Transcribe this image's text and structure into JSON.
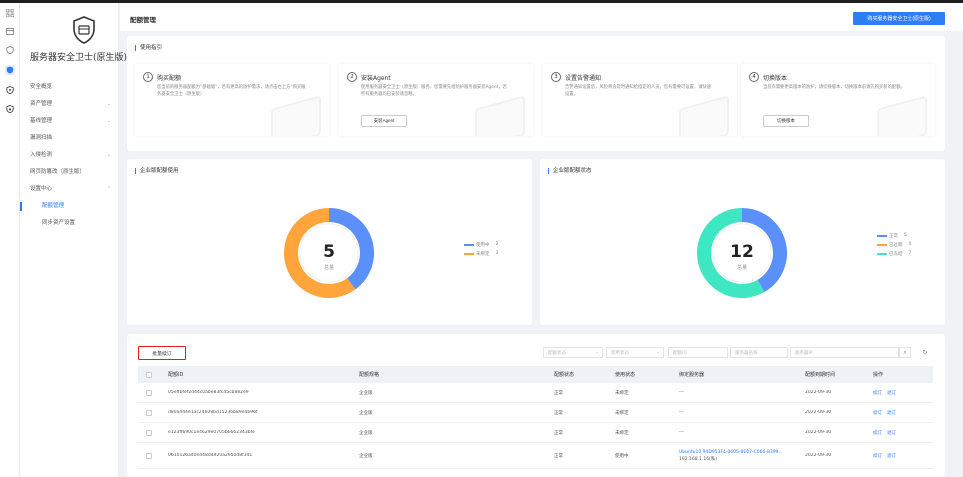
{
  "app": {
    "product_name": "服务器安全卫士(原生版)"
  },
  "rail_icons": [
    "apps-icon",
    "box-icon",
    "shield-check-icon",
    "shield-active-icon",
    "shield-icon",
    "shield-lock-icon"
  ],
  "sidebar": {
    "items": [
      {
        "label": "安全概览",
        "chevron": false
      },
      {
        "label": "资产管理",
        "chevron": true
      },
      {
        "label": "基线管理",
        "chevron": true
      },
      {
        "label": "漏洞扫描",
        "chevron": false
      },
      {
        "label": "入侵检测",
        "chevron": true
      },
      {
        "label": "网页防篡改（原生版）",
        "chevron": false
      },
      {
        "label": "设置中心",
        "chevron": true
      }
    ],
    "sub_items": [
      {
        "label": "配额管理",
        "active": true
      },
      {
        "label": "同步资产设置",
        "active": false
      }
    ]
  },
  "header": {
    "title": "配额管理",
    "buy_button": "购买服务器安全卫士(原生版)"
  },
  "guide": {
    "title": "使用指引",
    "steps": [
      {
        "num": "1",
        "title": "购买配额",
        "desc": "您当前的服务器配额为“基础版”，若有更高的防护需求，请点击右上方“购买服务器安全卫士（原生版）",
        "button": ""
      },
      {
        "num": "2",
        "title": "安装Agent",
        "desc": "使用服务器安全卫士（原生版）服务，您需要先给防护服务器安装Agent，若所有服务器均已安装请忽略。",
        "button": "安装Agent"
      },
      {
        "num": "3",
        "title": "设置告警通知",
        "desc": "告警通知设置后，风险将会及时通知给指定的人员，您有需要可设置，请快速设置。",
        "button": ""
      },
      {
        "num": "4",
        "title": "切换版本",
        "desc": "当您有需要更高版本的防护，请切换版本，切换版本前请先购买新的配额。",
        "button": "切换版本"
      }
    ]
  },
  "usage_card": {
    "title": "企业版配额使用",
    "total": "5",
    "total_label": "总量",
    "legend": [
      {
        "label": "使用中",
        "value": "2",
        "color": "#5b8ff9"
      },
      {
        "label": "未绑定",
        "value": "3",
        "color": "#ffa53b"
      }
    ]
  },
  "status_card": {
    "title": "企业版配额状态",
    "total": "12",
    "total_label": "总量",
    "legend": [
      {
        "label": "正常",
        "value": "5",
        "color": "#5b8ff9"
      },
      {
        "label": "已过期",
        "value": "0",
        "color": "#ffa53b"
      },
      {
        "label": "已冻结",
        "value": "7",
        "color": "#3ee6c2"
      }
    ]
  },
  "toolbar": {
    "batch_button": "批量续订",
    "filters": {
      "quota_status": "配额状态",
      "use_status": "使用状态",
      "quota_id": "配额ID",
      "server_name": "服务器名称",
      "server_ip": "服务器IP"
    }
  },
  "table": {
    "headers": {
      "id": "配额ID",
      "spec": "配额规格",
      "status": "配额状态",
      "use": "使用状态",
      "server": "绑定服务器",
      "expire": "配额到期时间",
      "ops": "操作"
    },
    "rows": [
      {
        "id": "05effbfef2d44c0abe83fc45cb882e9",
        "spec": "企业版",
        "status": "正常",
        "use": "未绑定",
        "server": "---",
        "server_ip": "",
        "expire": "2022-09-30",
        "op1": "续订",
        "op2": "退订"
      },
      {
        "id": "d80a444e1ac24608bd1523bb89e4b96f",
        "spec": "企业版",
        "status": "正常",
        "use": "未绑定",
        "server": "---",
        "server_ip": "",
        "expire": "2022-09-30",
        "op1": "续订",
        "op2": "退订"
      },
      {
        "id": "e123ff690c1e4629e0705b6662343bfe",
        "spec": "企业版",
        "status": "正常",
        "use": "未绑定",
        "server": "---",
        "server_ip": "",
        "expire": "2022-09-30",
        "op1": "续订",
        "op2": "退订"
      },
      {
        "id": "0610126a40e448d4920a2950d8f341",
        "spec": "企业版",
        "status": "正常",
        "use": "使用中",
        "server": "Ubuntu10 94D953F4-0605-8E07-C066-8399...",
        "server_ip": "192.168.1.16(私)",
        "expire": "2022-09-30",
        "op1": "续订",
        "op2": "退订"
      }
    ]
  }
}
